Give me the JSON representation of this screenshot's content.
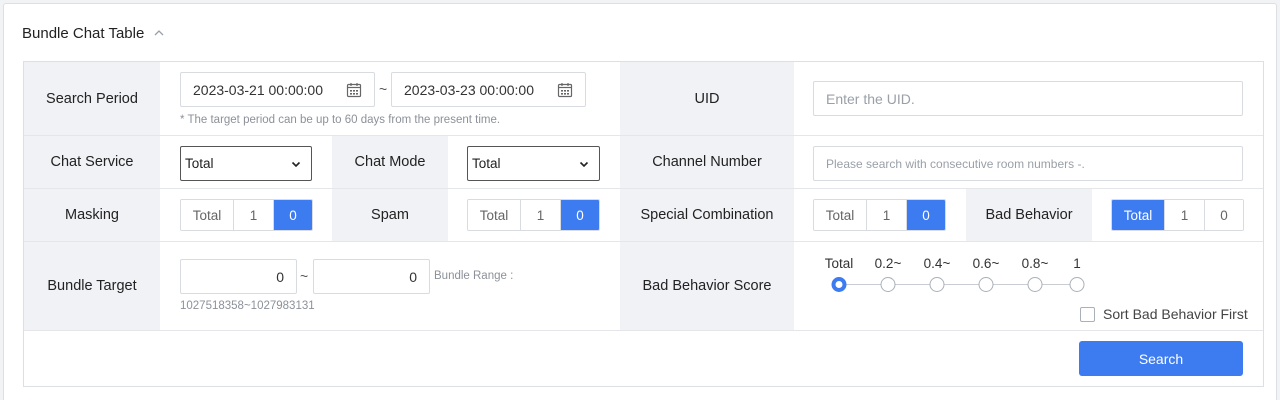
{
  "header": {
    "title": "Bundle Chat Table",
    "collapse_icon": "chevron-up-icon"
  },
  "search_period": {
    "label": "Search Period",
    "start": "2023-03-21 00:00:00",
    "end": "2023-03-23 00:00:00",
    "separator": "~",
    "hint": "* The target period can be up to 60 days from the present time.",
    "calendar_icon": "calendar-icon"
  },
  "uid": {
    "label": "UID",
    "placeholder": "Enter the UID."
  },
  "chat_service": {
    "label": "Chat Service",
    "value": "Total"
  },
  "chat_mode": {
    "label": "Chat Mode",
    "value": "Total"
  },
  "channel_number": {
    "label": "Channel Number",
    "placeholder": "Please search with consecutive room numbers -."
  },
  "masking": {
    "label": "Masking",
    "options": [
      "Total",
      "1",
      "0"
    ],
    "active": "0"
  },
  "spam": {
    "label": "Spam",
    "options": [
      "Total",
      "1",
      "0"
    ],
    "active": "0"
  },
  "special_combination": {
    "label": "Special Combination",
    "options": [
      "Total",
      "1",
      "0"
    ],
    "active": "0"
  },
  "bad_behavior": {
    "label": "Bad Behavior",
    "options": [
      "Total",
      "1",
      "0"
    ],
    "active": "Total"
  },
  "bundle_target": {
    "label": "Bundle Target",
    "from": "0",
    "to": "0",
    "separator": "~",
    "range_label": "Bundle Range :",
    "range_value": "1027518358~1027983131"
  },
  "bad_behavior_score": {
    "label": "Bad Behavior Score",
    "options": [
      "Total",
      "0.2~",
      "0.4~",
      "0.6~",
      "0.8~",
      "1"
    ],
    "selected": "Total",
    "sort_label": "Sort Bad Behavior First",
    "sort_checked": false
  },
  "search_button": {
    "label": "Search"
  },
  "colors": {
    "accent": "#3d7bf0",
    "label_bg": "#f0f2f6",
    "border": "#dcdfe4"
  }
}
